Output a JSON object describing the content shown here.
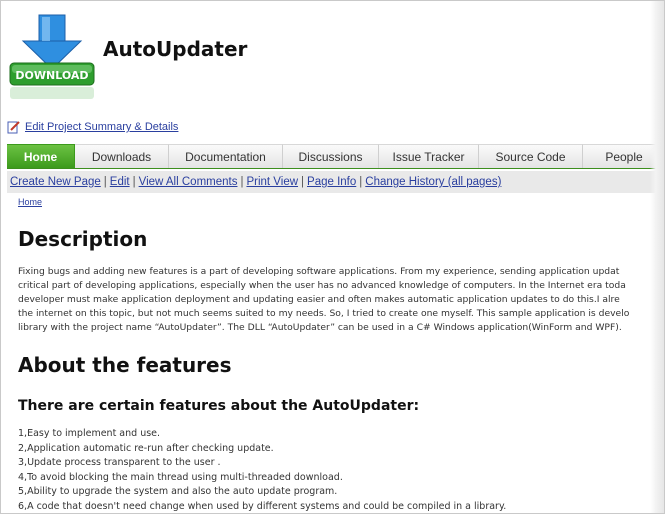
{
  "header": {
    "title": "AutoUpdater",
    "logo_text": "DOWNLOAD",
    "logo_icon": "download-arrow-icon",
    "edit_link": "Edit Project Summary & Details"
  },
  "tabs": [
    {
      "label": "Home",
      "active": true
    },
    {
      "label": "Downloads"
    },
    {
      "label": "Documentation"
    },
    {
      "label": "Discussions"
    },
    {
      "label": "Issue Tracker"
    },
    {
      "label": "Source Code"
    },
    {
      "label": "People"
    }
  ],
  "subnav": {
    "items": [
      "Create New Page",
      "Edit",
      "View All Comments",
      "Print View",
      "Page Info",
      "Change History (all pages)"
    ]
  },
  "breadcrumb": "Home",
  "description": {
    "heading": "Description",
    "lines": [
      "Fixing bugs and adding new features is a part of developing software applications. From my experience, sending application updat",
      "critical part of developing applications, especially when the user has no advanced knowledge of computers. In the Internet era toda",
      "developer must make application deployment and updating easier and often makes automatic application updates to do this.I alre",
      "the internet on this topic, but not much seems suited to my needs. So, I tried to create one myself. This sample application is develo",
      "library with the project name “AutoUpdater”. The DLL “AutoUpdater” can be used in a C# Windows application(WinForm and WPF)."
    ]
  },
  "features": {
    "heading": "About the features",
    "subheading": "There are certain features about the AutoUpdater:",
    "items": [
      "1,Easy to implement and use.",
      "2,Application automatic re-run after checking update.",
      "3,Update process transparent to the user .",
      "4,To avoid blocking the main thread using multi-threaded download.",
      "5,Ability to upgrade the system and also the auto update program.",
      "6,A code that doesn't need change when used by different systems and could be compiled in a library."
    ]
  },
  "colors": {
    "tab_active": "#3c9a1c",
    "link": "#2a3f9f",
    "logo_arrow": "#1e90e0",
    "logo_green": "#2e9e2e"
  }
}
